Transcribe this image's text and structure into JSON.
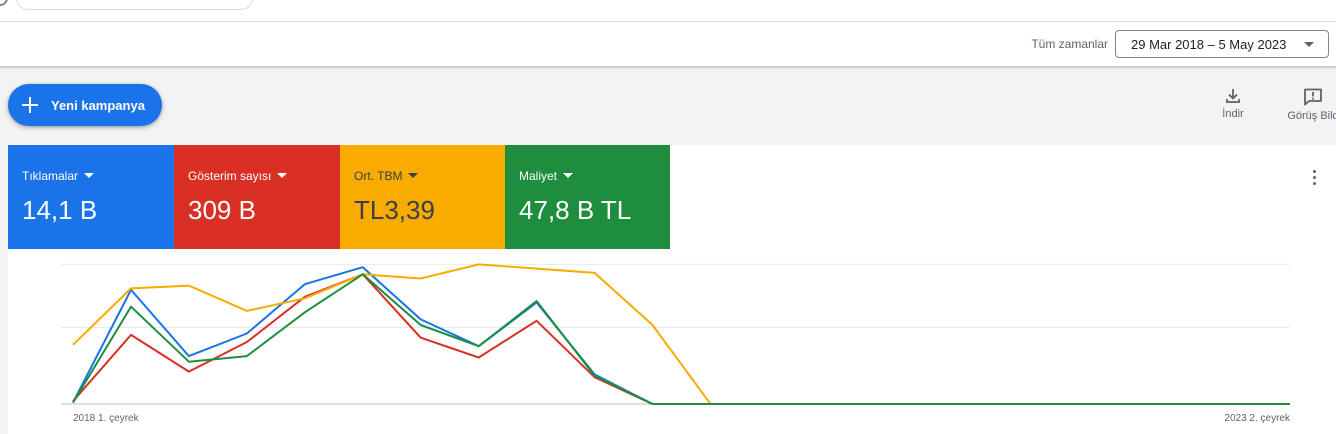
{
  "toolbar": {
    "date_range_label": "Tüm zamanlar",
    "date_range_value": "29 Mar 2018 – 5 May 2023"
  },
  "actions": {
    "new_campaign": "Yeni kampanya",
    "download": "İndir",
    "feedback": "Görüş Bild"
  },
  "metrics": [
    {
      "label": "Tıklamalar",
      "value": "14,1 B",
      "color": "#1a73e8"
    },
    {
      "label": "Gösterim sayısı",
      "value": "309 B",
      "color": "#d93025"
    },
    {
      "label": "Ort. TBM",
      "value": "TL3,39",
      "color": "#f9ab00"
    },
    {
      "label": "Maliyet",
      "value": "47,8 B TL",
      "color": "#1e8e3e"
    }
  ],
  "chart_data": {
    "type": "line",
    "x_start_label": "2018 1. çeyrek",
    "x_end_label": "2023 2. çeyrek",
    "ylim": [
      0,
      100
    ],
    "grid": true,
    "series": [
      {
        "name": "Tıklamalar",
        "color": "#1a73e8",
        "values": [
          1,
          81,
          34,
          50,
          85,
          97,
          60,
          41,
          72,
          21,
          0,
          0,
          0,
          0,
          0,
          0,
          0,
          0,
          0,
          0,
          0,
          0
        ]
      },
      {
        "name": "Gösterim sayısı",
        "color": "#d93025",
        "values": [
          2,
          49,
          23,
          44,
          76,
          92,
          47,
          33,
          59,
          19,
          0,
          0,
          0,
          0,
          0,
          0,
          0,
          0,
          0,
          0,
          0,
          0
        ]
      },
      {
        "name": "Ort. TBM",
        "color": "#f9ab00",
        "values": [
          42,
          82,
          84,
          66,
          75,
          92,
          89,
          99,
          96,
          93,
          56,
          0,
          0,
          0,
          0,
          0,
          0,
          0,
          0,
          0,
          0,
          0
        ]
      },
      {
        "name": "Maliyet",
        "color": "#1e8e3e",
        "values": [
          1,
          69,
          30,
          34,
          65,
          92,
          56,
          41,
          73,
          20,
          0,
          0,
          0,
          0,
          0,
          0,
          0,
          0,
          0,
          0,
          0,
          0
        ]
      }
    ]
  }
}
